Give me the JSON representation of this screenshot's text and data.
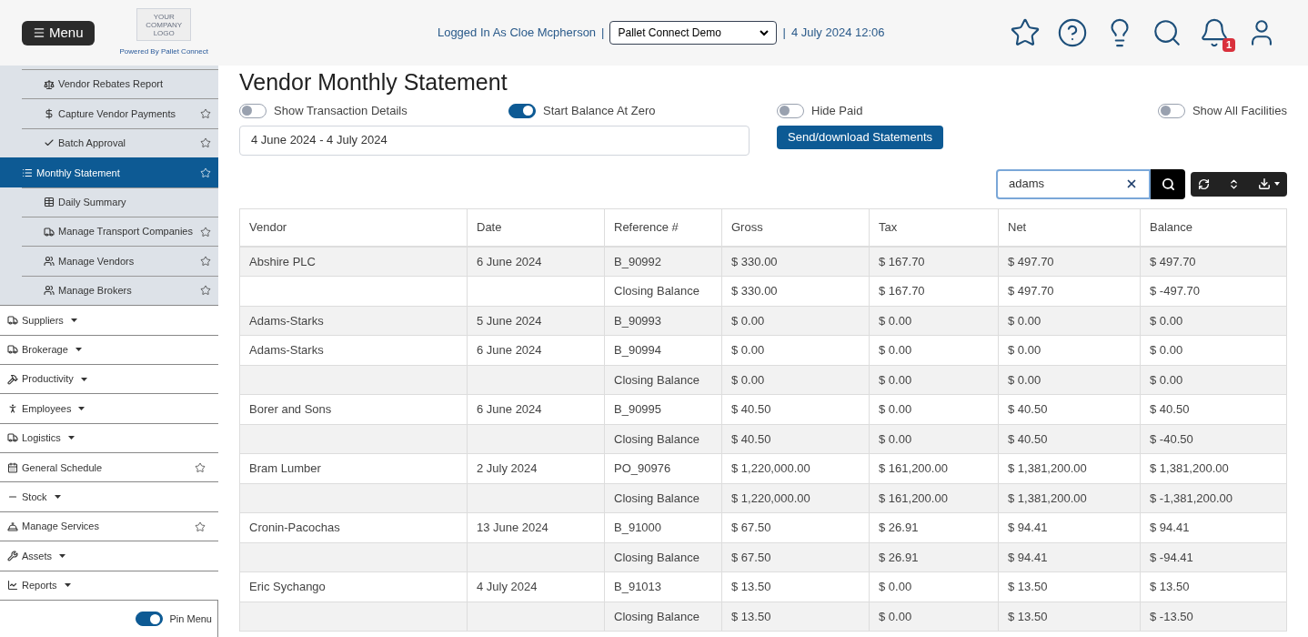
{
  "header": {
    "menu_button": "Menu",
    "logo_text": "YOUR COMPANY LOGO",
    "powered_by": "Powered By Pallet Connect",
    "logged_in": "Logged In As Cloe Mcpherson",
    "separator_left": "|",
    "company_select": "Pallet Connect Demo",
    "separator_right": "|",
    "datetime": "4 July 2024 12:06",
    "notification_count": "1"
  },
  "sidebar": {
    "subitems": [
      {
        "label": "Vendor Rebates Report",
        "kind": "plain",
        "selected": false
      },
      {
        "label": "Capture Vendor Payments",
        "kind": "favoritable",
        "selected": false
      },
      {
        "label": "Batch Approval",
        "kind": "favoritable",
        "selected": false
      },
      {
        "label": "Monthly Statement",
        "kind": "favoritable",
        "selected": true
      },
      {
        "label": "Daily Summary",
        "kind": "plain",
        "selected": false
      },
      {
        "label": "Manage Transport Companies",
        "kind": "favoritable",
        "selected": false
      },
      {
        "label": "Manage Vendors",
        "kind": "favoritable",
        "selected": false
      },
      {
        "label": "Manage Brokers",
        "kind": "favoritable",
        "selected": false
      }
    ],
    "sections": [
      {
        "label": "Suppliers",
        "kind": "dropdown"
      },
      {
        "label": "Brokerage",
        "kind": "dropdown"
      },
      {
        "label": "Productivity",
        "kind": "dropdown"
      },
      {
        "label": "Employees",
        "kind": "dropdown"
      },
      {
        "label": "Logistics",
        "kind": "dropdown"
      },
      {
        "label": "General Schedule",
        "kind": "favoritable"
      },
      {
        "label": "Stock",
        "kind": "dropdown"
      },
      {
        "label": "Manage Services",
        "kind": "favoritable"
      },
      {
        "label": "Assets",
        "kind": "dropdown"
      },
      {
        "label": "Reports",
        "kind": "dropdown"
      }
    ],
    "pin_menu": {
      "label": "Pin Menu",
      "on": true
    }
  },
  "page": {
    "title": "Vendor Monthly Statement",
    "toggles": [
      {
        "label": "Show Transaction Details",
        "on": false
      },
      {
        "label": "Start Balance At Zero",
        "on": true
      },
      {
        "label": "Hide Paid",
        "on": false
      },
      {
        "label": "Show All Facilities",
        "on": false
      }
    ],
    "date_range": "4 June 2024 - 4 July 2024",
    "send_button": "Send/download Statements",
    "search": {
      "value": "adams"
    }
  },
  "table": {
    "columns": [
      "Vendor",
      "Date",
      "Reference #",
      "Gross",
      "Tax",
      "Net",
      "Balance"
    ],
    "rows": [
      {
        "vendor": "Abshire PLC",
        "date": "6 June 2024",
        "reference": "B_90992",
        "gross": "$ 330.00",
        "tax": "$ 167.70",
        "net": "$ 497.70",
        "balance": "$ 497.70"
      },
      {
        "reference": "Closing Balance",
        "gross": "$ 330.00",
        "tax": "$ 167.70",
        "net": "$ 497.70",
        "balance": "$ -497.70"
      },
      {
        "vendor": "Adams-Starks",
        "date": "5 June 2024",
        "reference": "B_90993",
        "gross": "$ 0.00",
        "tax": "$ 0.00",
        "net": "$ 0.00",
        "balance": "$ 0.00"
      },
      {
        "vendor": "Adams-Starks",
        "date": "6 June 2024",
        "reference": "B_90994",
        "gross": "$ 0.00",
        "tax": "$ 0.00",
        "net": "$ 0.00",
        "balance": "$ 0.00"
      },
      {
        "reference": "Closing Balance",
        "gross": "$ 0.00",
        "tax": "$ 0.00",
        "net": "$ 0.00",
        "balance": "$ 0.00"
      },
      {
        "vendor": "Borer and Sons",
        "date": "6 June 2024",
        "reference": "B_90995",
        "gross": "$ 40.50",
        "tax": "$ 0.00",
        "net": "$ 40.50",
        "balance": "$ 40.50"
      },
      {
        "reference": "Closing Balance",
        "gross": "$ 40.50",
        "tax": "$ 0.00",
        "net": "$ 40.50",
        "balance": "$ -40.50"
      },
      {
        "vendor": "Bram Lumber",
        "date": "2 July 2024",
        "reference": "PO_90976",
        "gross": "$ 1,220,000.00",
        "tax": "$ 161,200.00",
        "net": "$ 1,381,200.00",
        "balance": "$ 1,381,200.00"
      },
      {
        "reference": "Closing Balance",
        "gross": "$ 1,220,000.00",
        "tax": "$ 161,200.00",
        "net": "$ 1,381,200.00",
        "balance": "$ -1,381,200.00"
      },
      {
        "vendor": "Cronin-Pacochas",
        "date": "13 June 2024",
        "reference": "B_91000",
        "gross": "$ 67.50",
        "tax": "$ 26.91",
        "net": "$ 94.41",
        "balance": "$ 94.41"
      },
      {
        "reference": "Closing Balance",
        "gross": "$ 67.50",
        "tax": "$ 26.91",
        "net": "$ 94.41",
        "balance": "$ -94.41"
      },
      {
        "vendor": "Eric Sychango",
        "date": "4 July 2024",
        "reference": "B_91013",
        "gross": "$ 13.50",
        "tax": "$ 0.00",
        "net": "$ 13.50",
        "balance": "$ 13.50"
      },
      {
        "reference": "Closing Balance",
        "gross": "$ 13.50",
        "tax": "$ 0.00",
        "net": "$ 13.50",
        "balance": "$ -13.50"
      }
    ]
  }
}
